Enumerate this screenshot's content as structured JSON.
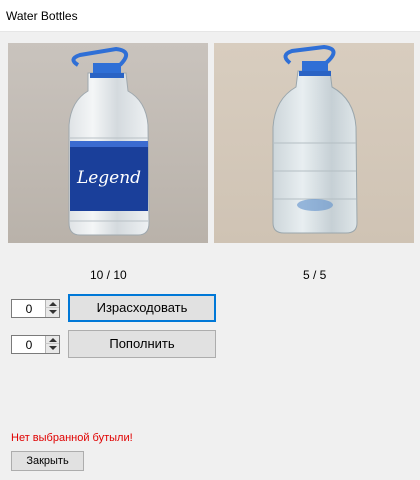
{
  "window": {
    "title": "Water Bottles"
  },
  "bottles": [
    {
      "count_text": "10 / 10",
      "has_label": true,
      "label_text": "Legend",
      "cap_color": "#2f6fd6"
    },
    {
      "count_text": "5 / 5",
      "has_label": false,
      "cap_color": "#2f6fd6"
    }
  ],
  "controls": {
    "consume": {
      "value": "0",
      "button_label": "Израсходовать"
    },
    "refill": {
      "value": "0",
      "button_label": "Пополнить"
    }
  },
  "status": {
    "message": "Нет выбранной бутыли!",
    "color": "#e00000"
  },
  "close_button": {
    "label": "Закрыть"
  }
}
